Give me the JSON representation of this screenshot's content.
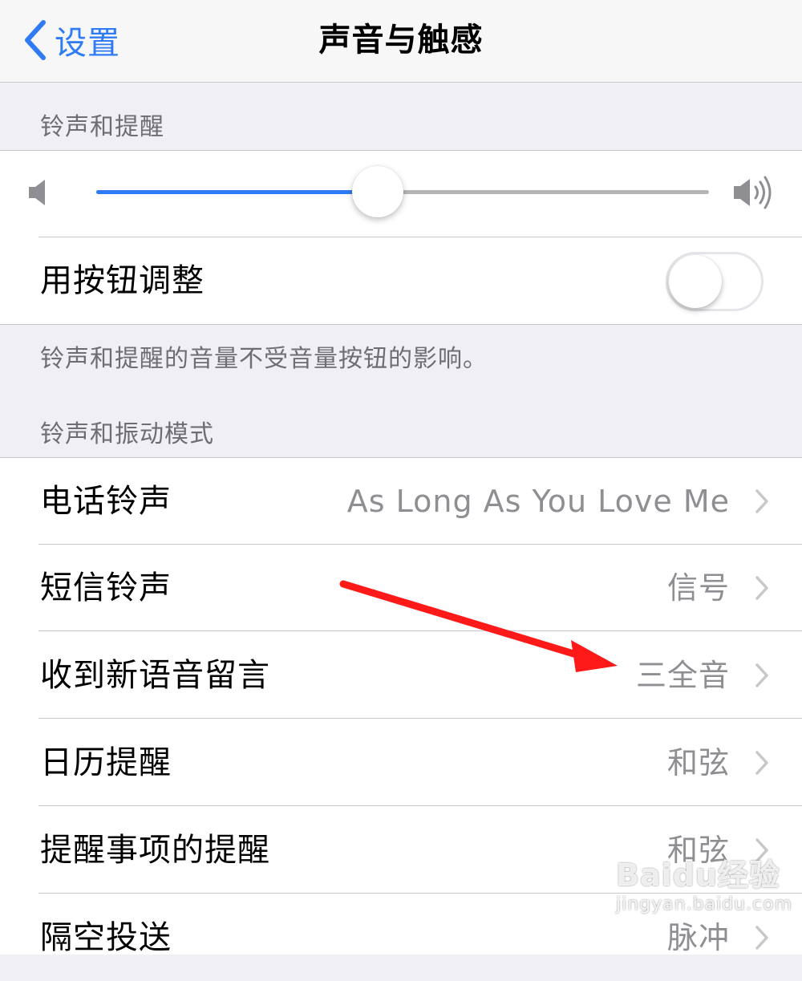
{
  "navbar": {
    "back_label": "设置",
    "title": "声音与触感"
  },
  "ringer_section": {
    "header": "铃声和提醒",
    "volume_level": 0.46,
    "change_with_buttons_label": "用按钮调整",
    "change_with_buttons_on": false,
    "footer": "铃声和提醒的音量不受音量按钮的影响。"
  },
  "patterns_section": {
    "header": "铃声和振动模式",
    "items": [
      {
        "label": "电话铃声",
        "value": "As Long As You Love Me"
      },
      {
        "label": "短信铃声",
        "value": "信号"
      },
      {
        "label": "收到新语音留言",
        "value": "三全音"
      },
      {
        "label": "日历提醒",
        "value": "和弦"
      },
      {
        "label": "提醒事项的提醒",
        "value": "和弦"
      },
      {
        "label": "隔空投送",
        "value": "脉冲"
      }
    ]
  },
  "annotation": {
    "arrow_color": "#ff1a1a"
  },
  "colors": {
    "accent": "#2f7bf5",
    "separator": "#c8c7cc",
    "background": "#efeff4"
  },
  "watermark": {
    "logo": "Baidu经验",
    "url": "jingyan.baidu.com"
  }
}
